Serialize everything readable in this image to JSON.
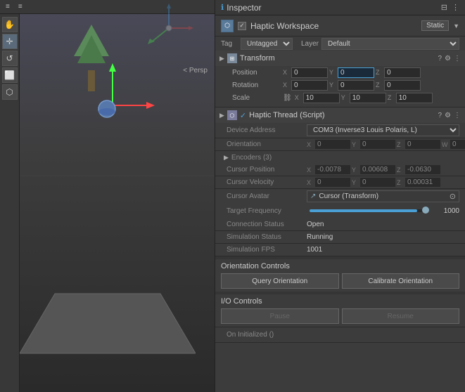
{
  "viewport": {
    "persp_label": "< Persp"
  },
  "inspector": {
    "title": "Inspector",
    "info_icon": "ℹ",
    "header_icons": [
      "⊟",
      "⋮"
    ]
  },
  "gameobject": {
    "name": "Haptic Workspace",
    "tag": "Untagged",
    "layer": "Default",
    "static_label": "Static"
  },
  "transform": {
    "component_name": "Transform",
    "position_label": "Position",
    "rotation_label": "Rotation",
    "scale_label": "Scale",
    "pos_x": "0",
    "pos_y": "0",
    "pos_z": "0",
    "rot_x": "0",
    "rot_y": "0",
    "rot_z": "0",
    "scale_x": "10",
    "scale_y": "10",
    "scale_z": "10"
  },
  "haptic_thread": {
    "component_name": "Haptic Thread (Script)",
    "device_address_label": "Device Address",
    "device_address_value": "COM3 (Inverse3 Louis Polaris, L)",
    "orientation_label": "Orientation",
    "orient_x": "0",
    "orient_y": "0",
    "orient_z": "0",
    "orient_w": "0",
    "encoders_label": "Encoders (3)",
    "cursor_position_label": "Cursor Position",
    "cursor_pos_x": "-0.0078",
    "cursor_pos_y": "0.00608",
    "cursor_pos_z": "-0.0630",
    "cursor_velocity_label": "Cursor Velocity",
    "cursor_vel_x": "0",
    "cursor_vel_y": "0",
    "cursor_vel_z": "0.00031",
    "cursor_avatar_label": "Cursor Avatar",
    "cursor_avatar_icon": "↗",
    "cursor_avatar_value": "Cursor (Transform)",
    "target_frequency_label": "Target Frequency",
    "target_frequency_value": "1000",
    "connection_status_label": "Connection Status",
    "connection_status_value": "Open",
    "simulation_status_label": "Simulation Status",
    "simulation_status_value": "Running",
    "simulation_fps_label": "Simulation FPS",
    "simulation_fps_value": "1001"
  },
  "orientation_controls": {
    "section_label": "Orientation Controls",
    "query_btn": "Query Orientation",
    "calibrate_btn": "Calibrate Orientation"
  },
  "io_controls": {
    "section_label": "I/O Controls",
    "pause_btn": "Pause",
    "resume_btn": "Resume"
  },
  "on_initialized": {
    "label": "On Initialized ()"
  },
  "sidebar": {
    "icons": [
      "✋",
      "⊕",
      "↺",
      "⬜",
      "⬡"
    ]
  }
}
